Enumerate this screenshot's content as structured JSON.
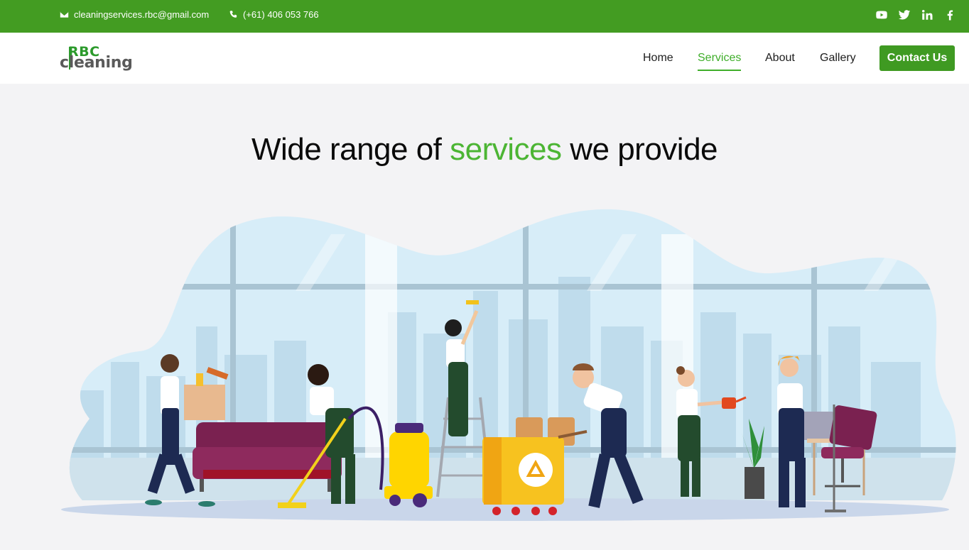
{
  "topbar": {
    "email": "cleaningservices.rbc@gmail.com",
    "phone": "(+61) 406 053 766",
    "icons": {
      "email": "envelope-icon",
      "phone": "phone-icon"
    },
    "socials": [
      "youtube-icon",
      "twitter-icon",
      "linkedin-icon",
      "facebook-icon"
    ]
  },
  "logo": {
    "line1": "RBC",
    "line2": "cleaning"
  },
  "nav": {
    "items": [
      {
        "label": "Home",
        "active": false
      },
      {
        "label": "Services",
        "active": true
      },
      {
        "label": "About",
        "active": false
      },
      {
        "label": "Gallery",
        "active": false
      }
    ],
    "cta": "Contact Us"
  },
  "hero": {
    "title_before": "Wide range of ",
    "title_accent": "services",
    "title_after": " we provide"
  },
  "colors": {
    "brand_green": "#439c22",
    "accent_green": "#4cb534",
    "page_bg": "#f3f3f5"
  }
}
